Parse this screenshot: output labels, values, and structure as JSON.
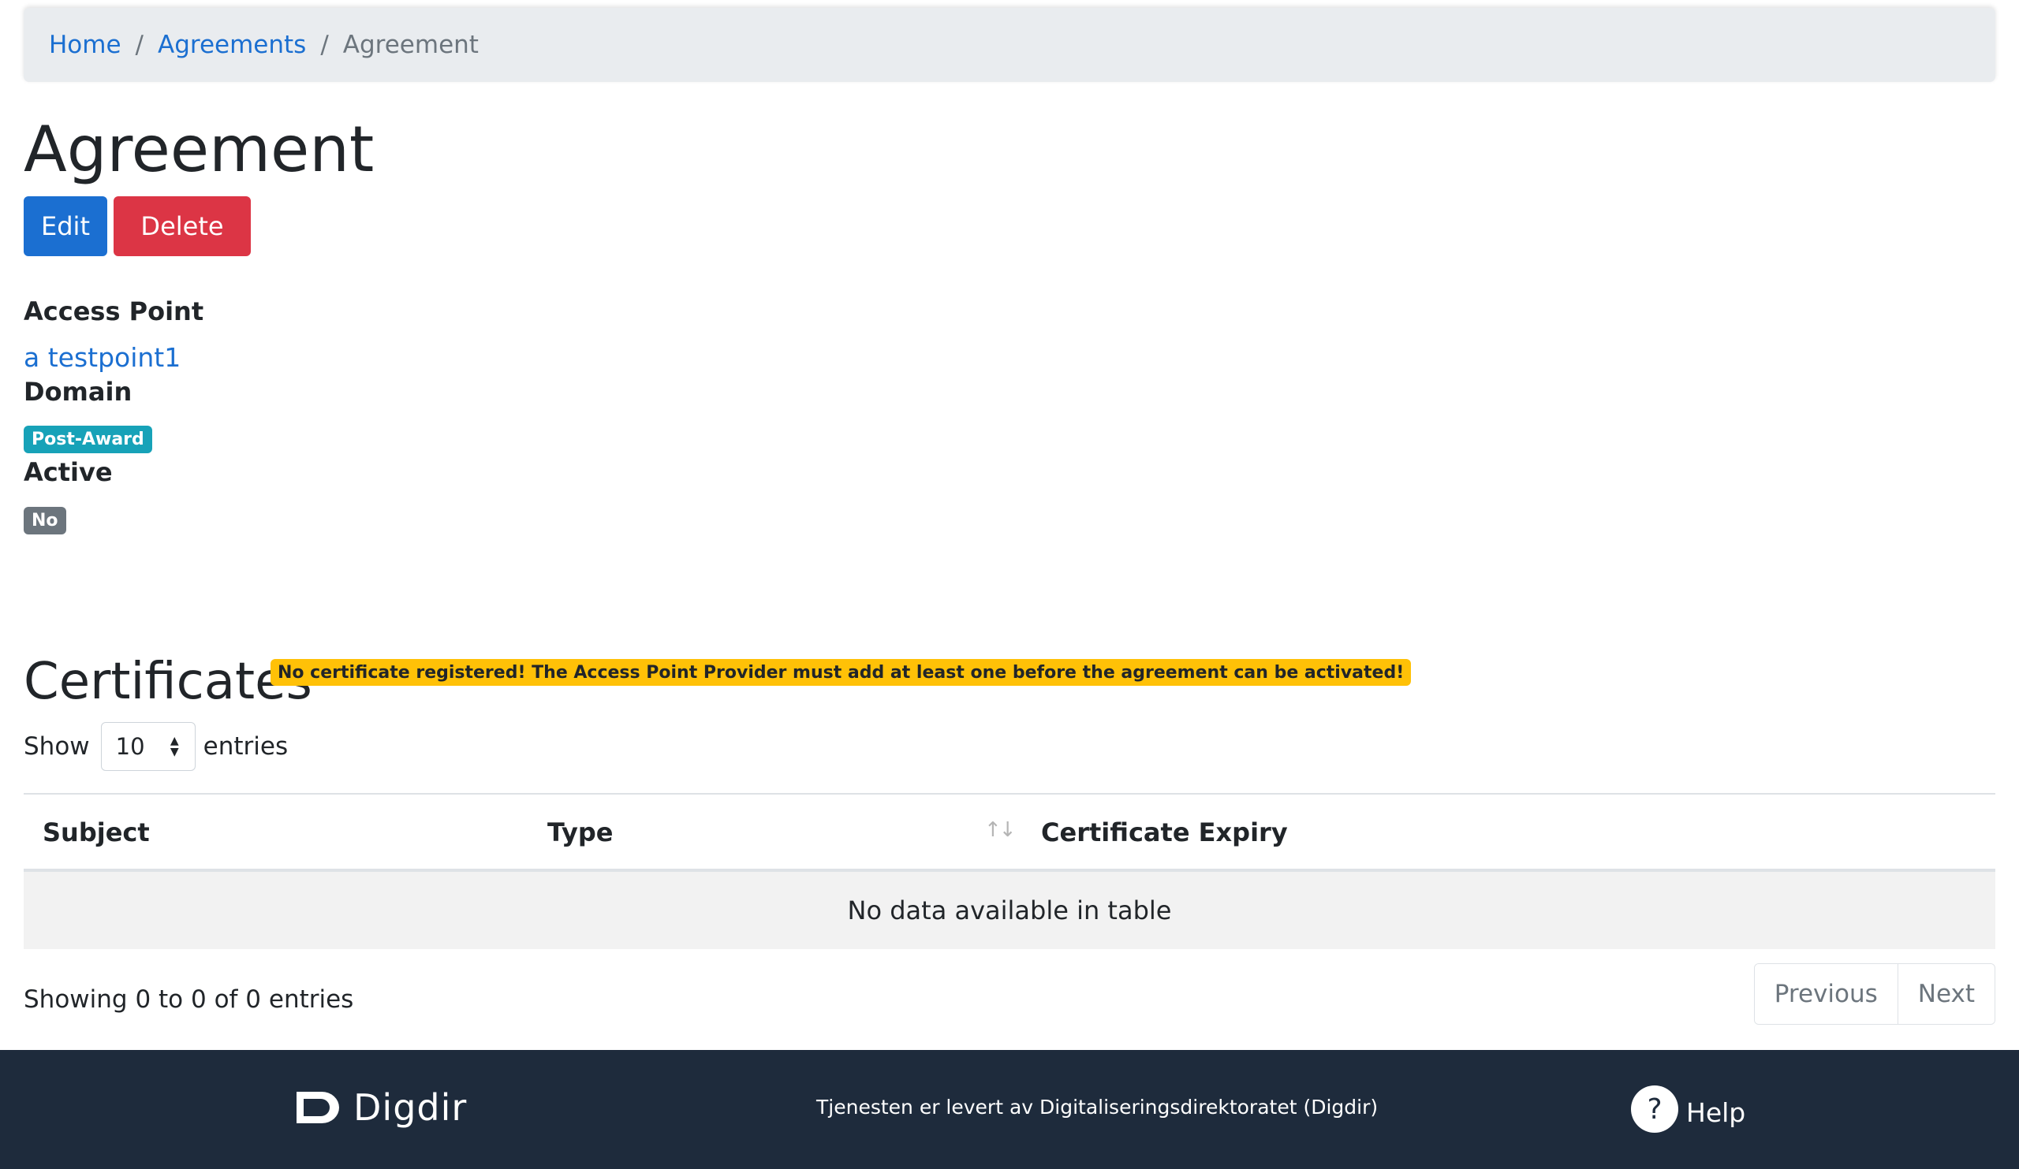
{
  "breadcrumb": {
    "home": "Home",
    "agreements": "Agreements",
    "current": "Agreement",
    "separator": "/"
  },
  "page": {
    "title": "Agreement"
  },
  "actions": {
    "edit_label": "Edit",
    "delete_label": "Delete"
  },
  "fields": {
    "access_point_label": "Access Point",
    "access_point_value": "a testpoint1",
    "domain_label": "Domain",
    "domain_value": "Post-Award",
    "active_label": "Active",
    "active_value": "No"
  },
  "certificates": {
    "title": "Certificates",
    "warning": "No certificate registered! The Access Point Provider must add at least one before the agreement can be activated!",
    "show_label": "Show",
    "entries_label": "entries",
    "page_length": "10",
    "columns": [
      "Subject",
      "Type",
      "Certificate Expiry"
    ],
    "empty_message": "No data available in table",
    "info": "Showing 0 to 0 of 0 entries",
    "pagination": {
      "previous": "Previous",
      "next": "Next"
    }
  },
  "footer": {
    "logo_text": "Digdir",
    "provider_text": "Tjenesten er levert av Digitaliseringsdirektoratet (Digdir)",
    "help_label": "Help",
    "help_icon_glyph": "?"
  },
  "colors": {
    "primary": "#1b6fd1",
    "danger": "#dc3545",
    "info": "#17a2b8",
    "secondary": "#6c757d",
    "warning": "#ffc107",
    "footer_bg": "#1e2b3c"
  }
}
